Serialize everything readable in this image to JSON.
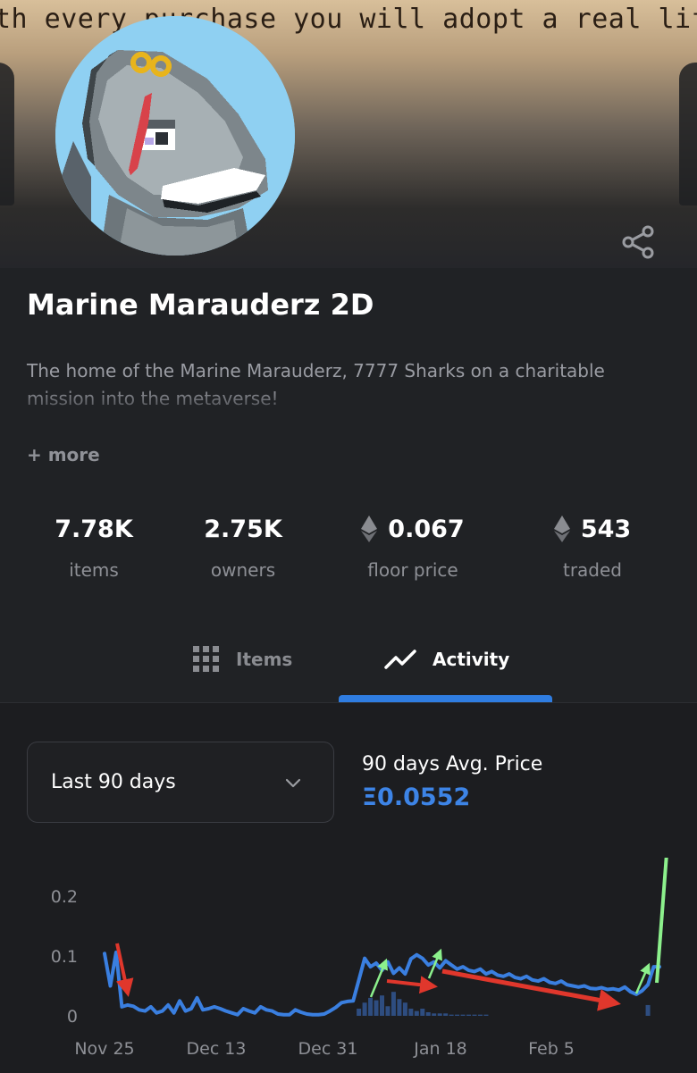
{
  "banner": {
    "text": "th every purchase you will adopt a real life sha"
  },
  "collection": {
    "title": "Marine Marauderz 2D",
    "description": "The home of the Marine Marauderz, 7777 Sharks on a charitable mission into the metaverse!",
    "more_label": "+ more"
  },
  "stats": [
    {
      "value": "7.78K",
      "label": "items",
      "icon": ""
    },
    {
      "value": "2.75K",
      "label": "owners",
      "icon": ""
    },
    {
      "value": "0.067",
      "label": "floor price",
      "icon": "ethereum-icon"
    },
    {
      "value": "543",
      "label": "traded",
      "icon": "ethereum-icon"
    }
  ],
  "tabs": {
    "items_label": "Items",
    "activity_label": "Activity",
    "active": "activity"
  },
  "filter": {
    "range_label": "Last 90 days"
  },
  "average": {
    "label": "90 days Avg. Price",
    "value": "Ξ0.0552"
  },
  "colors": {
    "accent": "#2f7de1",
    "line": "#3a7fe0",
    "annotation_red": "#e0372c",
    "annotation_green": "#8cf08c"
  },
  "chart_data": {
    "type": "line",
    "x_ticks": [
      "Nov 25",
      "Dec 13",
      "Dec 31",
      "Jan 18",
      "Feb 5"
    ],
    "y_ticks": [
      "0.2",
      "0.1",
      "0"
    ],
    "ylim": [
      0,
      0.2
    ],
    "series": [
      {
        "values": [
          0.104,
          0.05,
          0.106,
          0.015,
          0.018,
          0.016,
          0.01,
          0.008,
          0.015,
          0.005,
          0.008,
          0.018,
          0.005,
          0.025,
          0.008,
          0.012,
          0.03,
          0.01,
          0.012,
          0.015,
          0.012,
          0.008,
          0.005,
          0.002,
          0.012,
          0.008,
          0.005,
          0.015,
          0.01,
          0.008,
          0.003,
          0.002,
          0.002,
          0.01,
          0.006,
          0.003,
          0.002,
          0.002,
          0.003,
          0.008,
          0.014,
          0.022,
          0.024,
          0.025,
          0.06,
          0.096,
          0.082,
          0.088,
          0.076,
          0.09,
          0.071,
          0.08,
          0.07,
          0.095,
          0.102,
          0.096,
          0.085,
          0.09,
          0.08,
          0.092,
          0.085,
          0.078,
          0.082,
          0.076,
          0.074,
          0.078,
          0.07,
          0.074,
          0.068,
          0.066,
          0.07,
          0.064,
          0.062,
          0.066,
          0.06,
          0.058,
          0.062,
          0.056,
          0.054,
          0.058,
          0.052,
          0.05,
          0.048,
          0.05,
          0.046,
          0.045,
          0.047,
          0.044,
          0.045,
          0.043,
          0.048,
          0.04,
          0.036,
          0.042,
          0.052,
          0.082,
          0.082
        ]
      }
    ],
    "volume": [
      0,
      0,
      0,
      0,
      0,
      0,
      0,
      0,
      0,
      0,
      0,
      0,
      0,
      0,
      0,
      0,
      0,
      0,
      0,
      0,
      0,
      0,
      0,
      0,
      0,
      0,
      0,
      0,
      0,
      0,
      0,
      0,
      0,
      0,
      0,
      0,
      0,
      0,
      0,
      0,
      0,
      0,
      0,
      0,
      0.012,
      0.022,
      0.03,
      0.026,
      0.034,
      0.016,
      0.04,
      0.028,
      0.022,
      0.012,
      0.008,
      0.012,
      0.006,
      0.004,
      0.004,
      0.004,
      0.002,
      0.002,
      0.002,
      0.002,
      0.002,
      0.002,
      0.002,
      0,
      0,
      0,
      0,
      0,
      0,
      0,
      0,
      0,
      0,
      0,
      0,
      0,
      0,
      0,
      0,
      0,
      0,
      0,
      0,
      0,
      0,
      0,
      0,
      0,
      0,
      0,
      0.018,
      0,
      0
    ],
    "grid": false
  }
}
